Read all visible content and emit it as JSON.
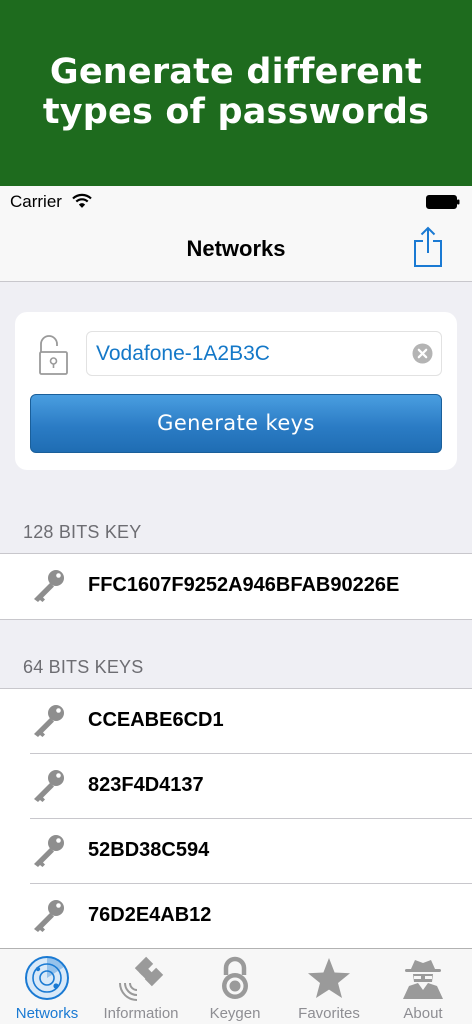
{
  "banner": {
    "line1": "Generate different",
    "line2": "types of passwords"
  },
  "status_bar": {
    "carrier": "Carrier"
  },
  "nav": {
    "title": "Networks"
  },
  "form": {
    "ssid_value": "Vodafone-1A2B3C",
    "generate_label": "Generate keys"
  },
  "sections": [
    {
      "header": "128 BITS KEY",
      "keys": [
        "FFC1607F9252A946BFAB90226E"
      ]
    },
    {
      "header": "64 BITS KEYS",
      "keys": [
        "CCEABE6CD1",
        "823F4D4137",
        "52BD38C594",
        "76D2E4AB12"
      ]
    }
  ],
  "tabs": [
    {
      "label": "Networks",
      "icon": "radar-icon",
      "active": true
    },
    {
      "label": "Information",
      "icon": "satellite-icon",
      "active": false
    },
    {
      "label": "Keygen",
      "icon": "padlock-icon",
      "active": false
    },
    {
      "label": "Favorites",
      "icon": "star-icon",
      "active": false
    },
    {
      "label": "About",
      "icon": "spy-icon",
      "active": false
    }
  ],
  "colors": {
    "banner": "#1e6b1e",
    "accent": "#1a7ad3",
    "button": "#2b7cc5"
  }
}
